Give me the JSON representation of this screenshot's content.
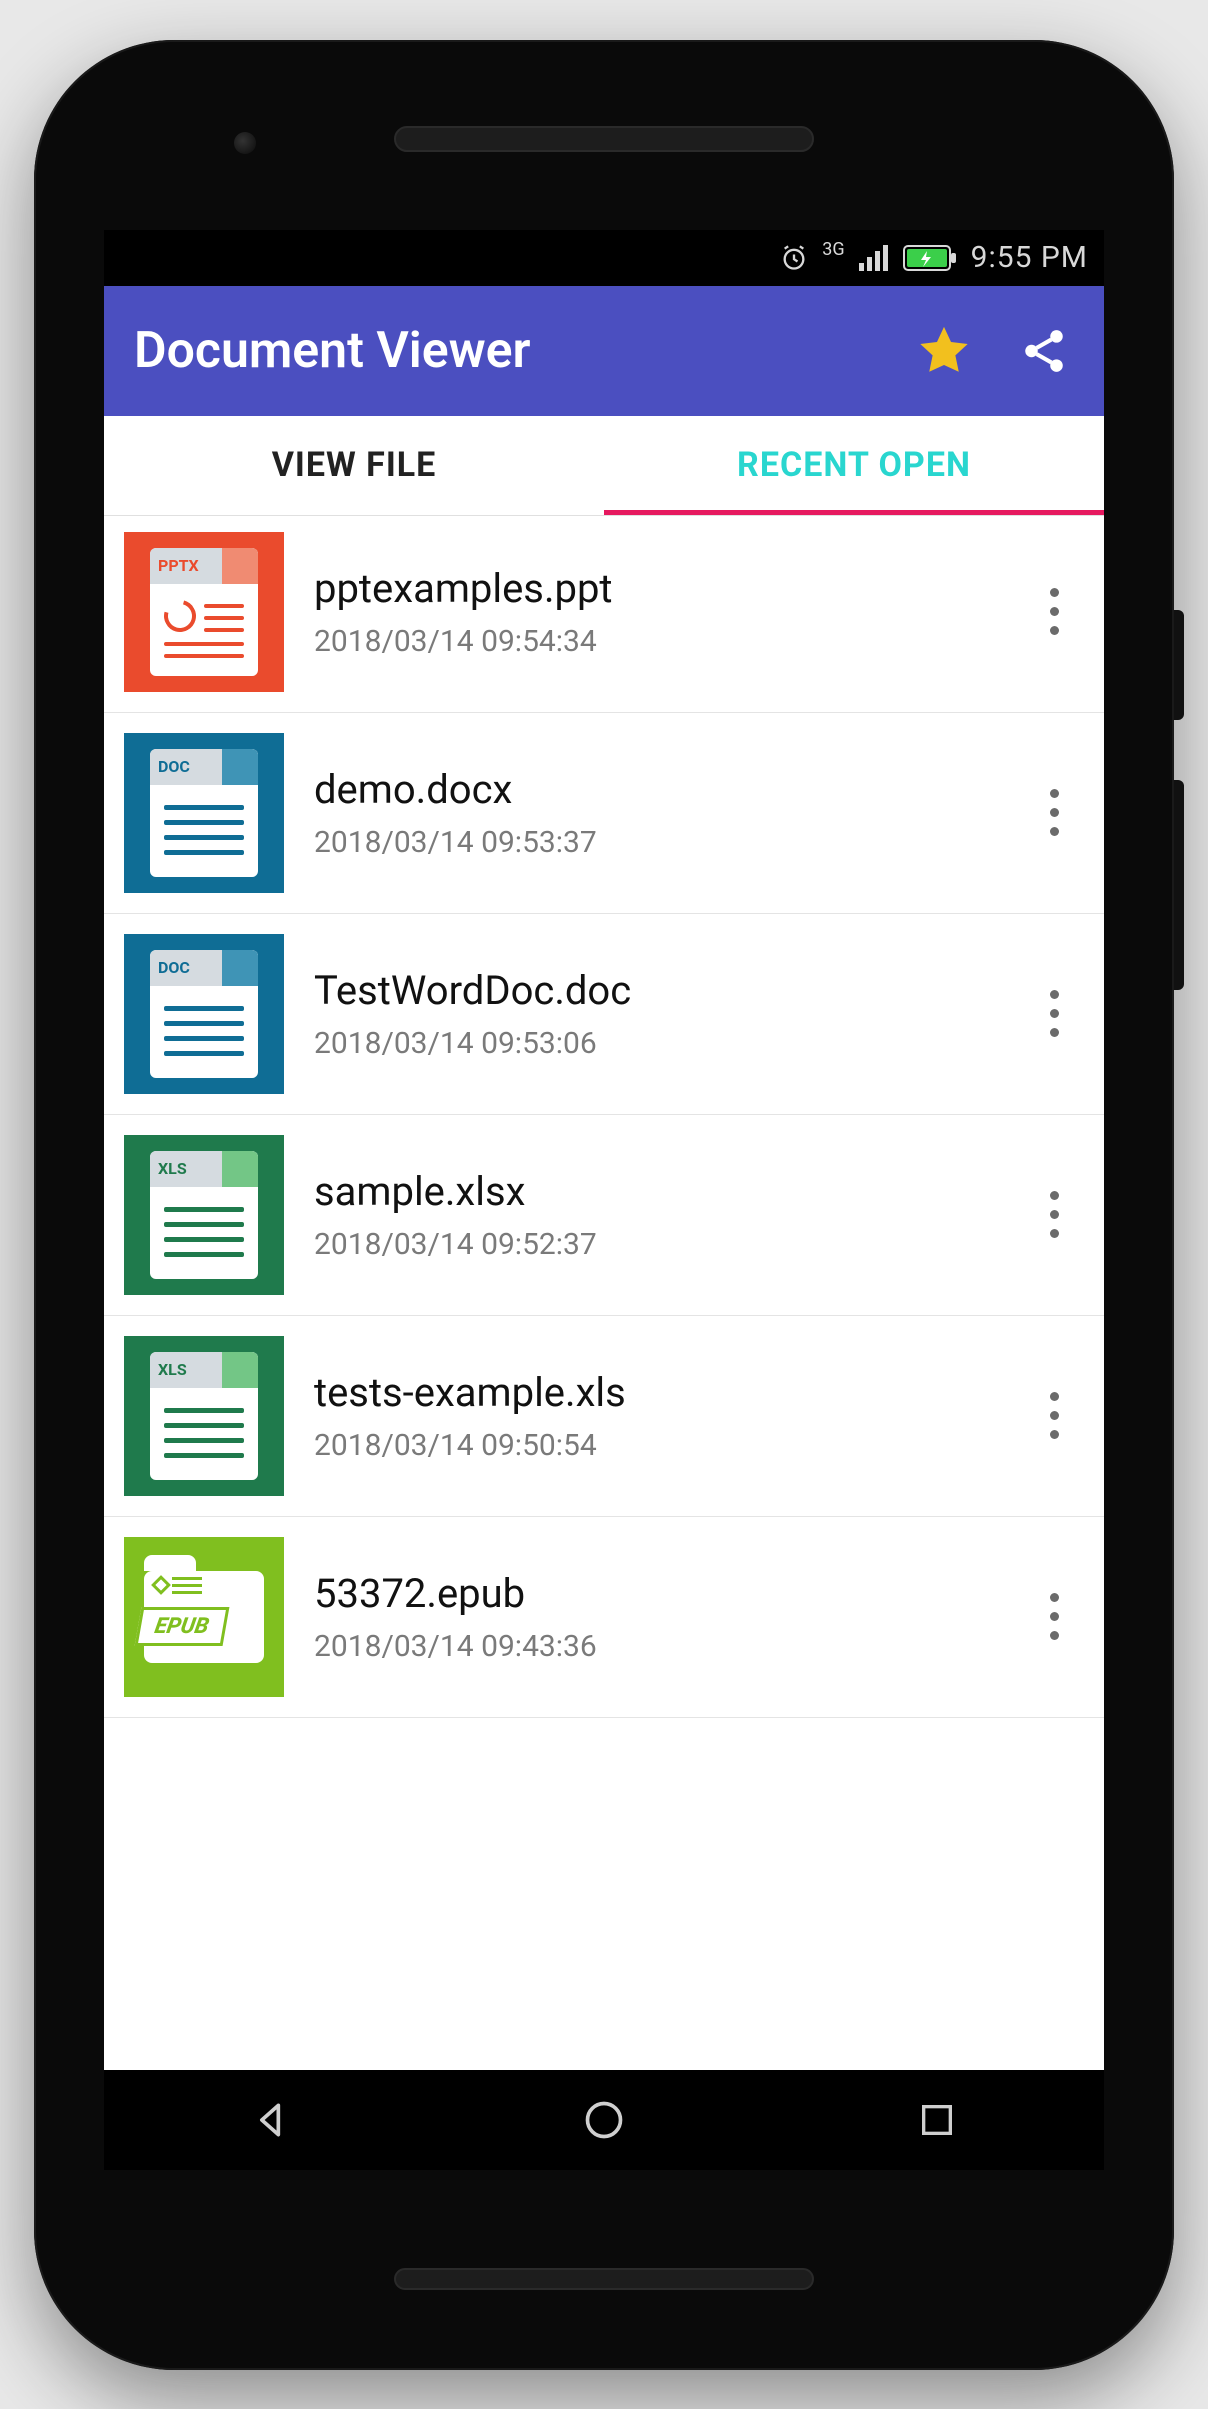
{
  "statusbar": {
    "network_label": "3G",
    "time": "9:55 PM"
  },
  "appbar": {
    "title": "Document Viewer"
  },
  "tabs": {
    "view_file": "VIEW FILE",
    "recent_open": "RECENT OPEN",
    "active_index": 1
  },
  "files": [
    {
      "name": "pptexamples.ppt",
      "date": "2018/03/14 09:54:34",
      "type": "pptx",
      "type_label": "PPTX"
    },
    {
      "name": "demo.docx",
      "date": "2018/03/14 09:53:37",
      "type": "doc",
      "type_label": "DOC"
    },
    {
      "name": "TestWordDoc.doc",
      "date": "2018/03/14 09:53:06",
      "type": "doc",
      "type_label": "DOC"
    },
    {
      "name": "sample.xlsx",
      "date": "2018/03/14 09:52:37",
      "type": "xls",
      "type_label": "XLS"
    },
    {
      "name": "tests-example.xls",
      "date": "2018/03/14 09:50:54",
      "type": "xls",
      "type_label": "XLS"
    },
    {
      "name": "53372.epub",
      "date": "2018/03/14 09:43:36",
      "type": "epub",
      "type_label": "EPUB"
    }
  ],
  "colors": {
    "appbar": "#4b4fc0",
    "tab_active": "#29d6cf",
    "tab_indicator": "#e6195f",
    "star": "#f2c01e"
  }
}
